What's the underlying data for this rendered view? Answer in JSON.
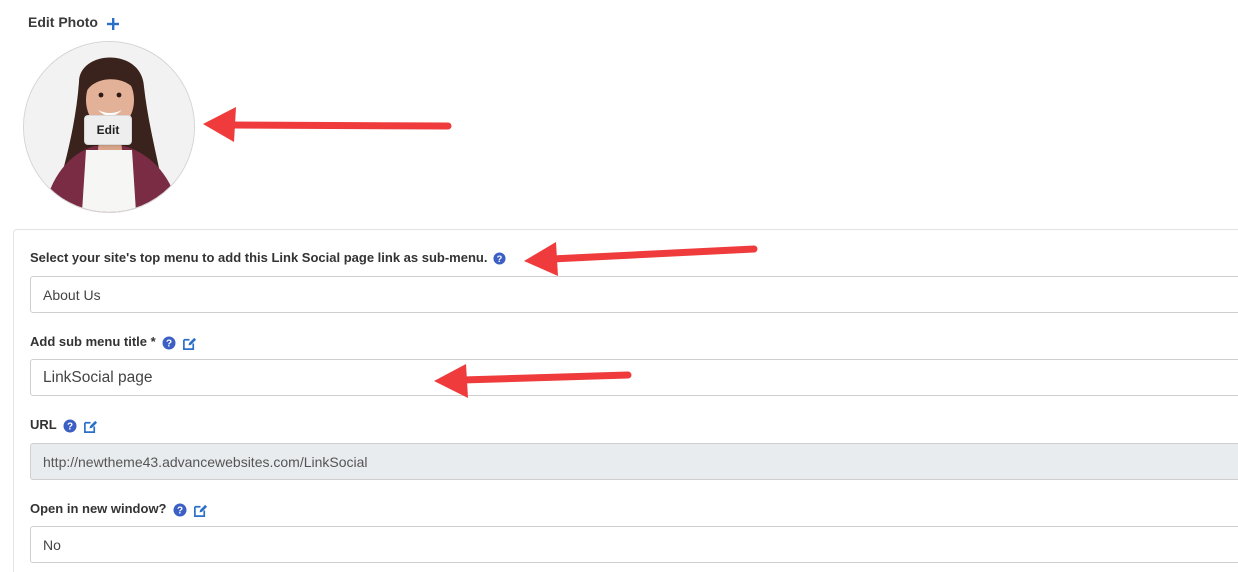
{
  "photo": {
    "title": "Edit Photo",
    "edit_label": "Edit",
    "add_icon": "plus-icon"
  },
  "form": {
    "menu_select": {
      "label": "Select your site's top menu to add this Link Social page link as sub-menu.",
      "value": "About Us",
      "help_icon": "question-circle-icon"
    },
    "sub_menu_title": {
      "label": "Add sub menu title *",
      "value": "LinkSocial page",
      "help_icon": "question-circle-icon",
      "edit_icon": "pencil-square-icon"
    },
    "url": {
      "label": "URL",
      "value": "http://newtheme43.advancewebsites.com/LinkSocial",
      "help_icon": "question-circle-icon",
      "edit_icon": "pencil-square-icon"
    },
    "new_window": {
      "label": "Open in new window?",
      "value": "No",
      "help_icon": "question-circle-icon",
      "edit_icon": "pencil-square-icon"
    }
  },
  "colors": {
    "accent_blue": "#2a6fc9",
    "help_blue": "#3b5fc4",
    "annotation_red": "#ef3b3b",
    "disabled_bg": "#e9ecef"
  }
}
